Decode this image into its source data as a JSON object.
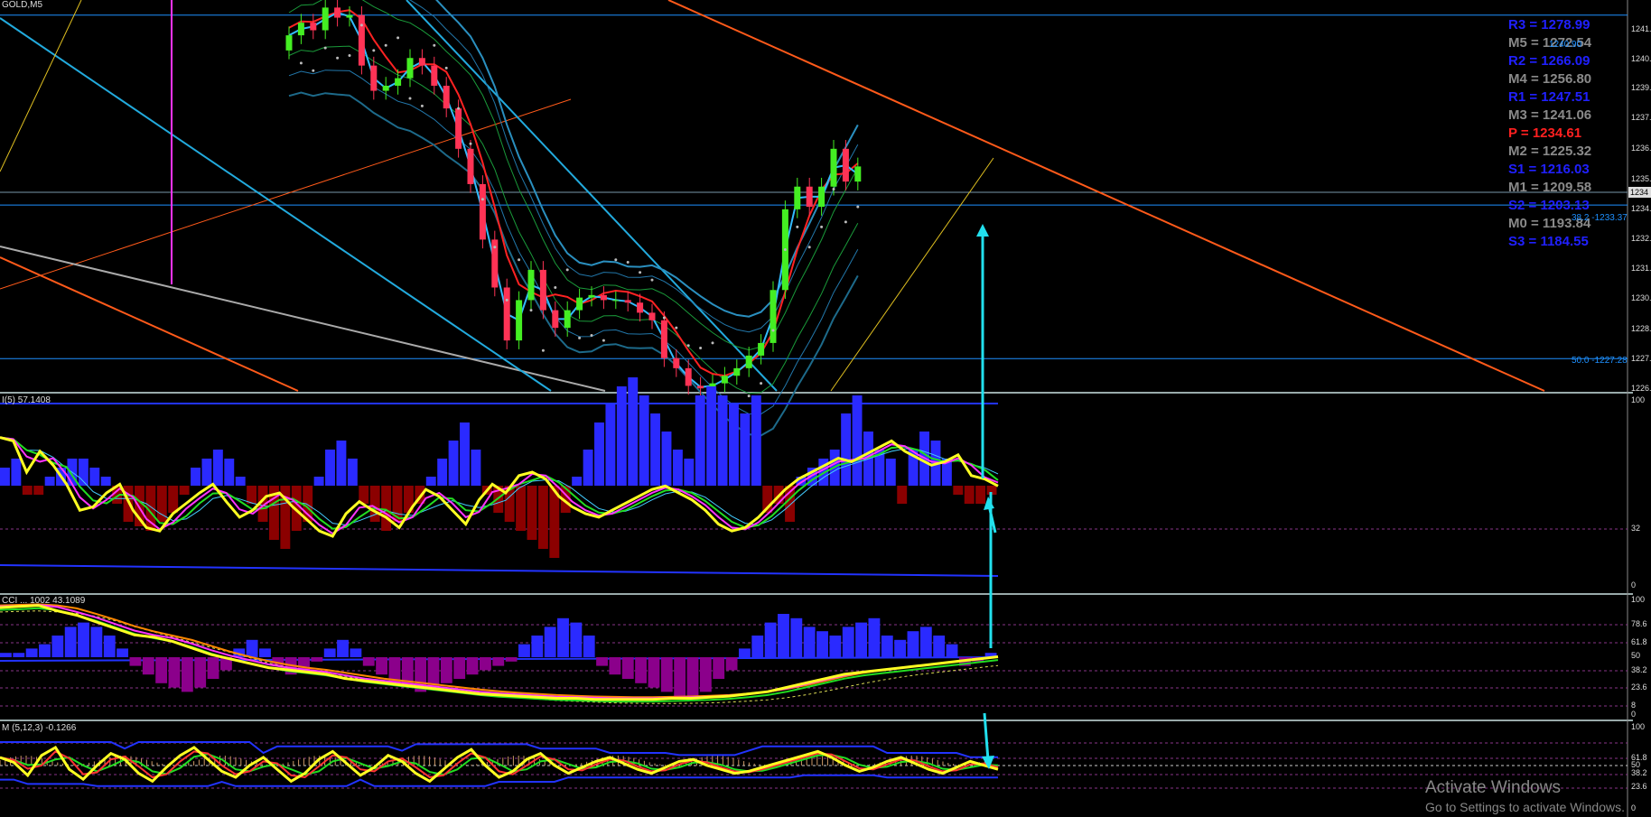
{
  "window": {
    "symbol_title": "GOLD,M5"
  },
  "chart_data": [
    {
      "type": "candlestick",
      "title": "GOLD,M5",
      "ylim": [
        1226,
        1241.5
      ],
      "y_ticks": [
        "1241.",
        "1240.",
        "1239.",
        "1237.",
        "1236.",
        "1235.",
        "1234.",
        "1232.",
        "1231.",
        "1230.",
        "1228.",
        "1227.",
        "1226."
      ],
      "current_price_label": "1234",
      "closes": [
        1240.1,
        1240.6,
        1240.3,
        1241.2,
        1240.8,
        1240.9,
        1238.9,
        1237.9,
        1238.1,
        1238.4,
        1239.2,
        1238.9,
        1238.1,
        1237.2,
        1235.6,
        1234.2,
        1232.0,
        1230.1,
        1228.0,
        1229.6,
        1230.8,
        1229.2,
        1228.5,
        1229.2,
        1229.7,
        1229.8,
        1229.6,
        1229.6,
        1229.5,
        1229.1,
        1228.8,
        1227.3,
        1226.9,
        1226.2,
        1226.1,
        1226.3,
        1226.6,
        1226.9,
        1227.4,
        1227.9,
        1230.0,
        1233.2,
        1234.1,
        1233.3,
        1234.1,
        1235.6,
        1234.3,
        1234.9
      ],
      "horizontal_levels": [
        {
          "label": "1240.90",
          "price": 1240.9
        },
        {
          "label": "38.2 -1233.37",
          "price": 1233.37
        },
        {
          "label": "50.0 -1227.28",
          "price": 1227.28
        }
      ],
      "pivot_levels": [
        {
          "label": "R3 = 1278.99",
          "color": "#2020ff"
        },
        {
          "label": "M5 = 1272.54",
          "color": "#8a8a8a"
        },
        {
          "label": "R2 = 1266.09",
          "color": "#2020ff"
        },
        {
          "label": "M4 = 1256.80",
          "color": "#8a8a8a"
        },
        {
          "label": "R1 = 1247.51",
          "color": "#2020ff"
        },
        {
          "label": "M3 = 1241.06",
          "color": "#8a8a8a"
        },
        {
          "label": "P  = 1234.61",
          "color": "#ff2020"
        },
        {
          "label": "M2 = 1225.32",
          "color": "#8a8a8a"
        },
        {
          "label": "S1 = 1216.03",
          "color": "#2020ff"
        },
        {
          "label": "M1 = 1209.58",
          "color": "#8a8a8a"
        },
        {
          "label": "S2 = 1203.13",
          "color": "#2020ff"
        },
        {
          "label": "M0 = 1193.84",
          "color": "#8a8a8a"
        },
        {
          "label": "S3 = 1184.55",
          "color": "#2020ff"
        }
      ]
    },
    {
      "type": "histogram+line",
      "title": "(5) 57.1408",
      "ylim": [
        0,
        100
      ],
      "y_ticks": [
        "100",
        "32",
        "0"
      ],
      "histogram": [
        4,
        6,
        -2,
        -2,
        2,
        4,
        6,
        6,
        4,
        2,
        -4,
        -8,
        -9,
        -10,
        -8,
        -6,
        -2,
        4,
        6,
        8,
        6,
        2,
        -4,
        -8,
        -12,
        -14,
        -10,
        -8,
        2,
        8,
        10,
        6,
        -4,
        -8,
        -10,
        -8,
        -6,
        -4,
        2,
        6,
        10,
        14,
        8,
        -2,
        -6,
        -8,
        -10,
        -12,
        -14,
        -16,
        -6,
        2,
        8,
        14,
        18,
        22,
        24,
        20,
        16,
        12,
        8,
        6,
        20,
        22,
        20,
        18,
        16,
        20,
        -6,
        -4,
        -8,
        2,
        4,
        6,
        8,
        16,
        20,
        12,
        8,
        6,
        -4,
        8,
        12,
        10,
        6,
        -2,
        -4,
        -4,
        -2
      ],
      "line_values": [
        82,
        80,
        62,
        74,
        66,
        55,
        40,
        42,
        50,
        55,
        40,
        30,
        28,
        38,
        44,
        50,
        55,
        45,
        36,
        40,
        48,
        50,
        42,
        35,
        28,
        25,
        38,
        45,
        40,
        36,
        30,
        42,
        52,
        48,
        40,
        32,
        46,
        55,
        50,
        60,
        62,
        58,
        48,
        42,
        38,
        36,
        40,
        44,
        48,
        52,
        54,
        50,
        46,
        40,
        32,
        28,
        30,
        36,
        44,
        52,
        58,
        62,
        66,
        70,
        68,
        72,
        76,
        80,
        74,
        70,
        66,
        68,
        72,
        60,
        58,
        54
      ]
    },
    {
      "type": "histogram+line",
      "title": "CCI 43.1089",
      "y_ticks": [
        "100",
        "78.6",
        "61.8",
        "50",
        "38.2",
        "23.6",
        "8",
        "0"
      ],
      "histogram": [
        2,
        2,
        4,
        6,
        10,
        14,
        16,
        14,
        10,
        4,
        -4,
        -8,
        -12,
        -14,
        -16,
        -14,
        -10,
        -6,
        4,
        8,
        4,
        -4,
        -8,
        -6,
        -2,
        4,
        8,
        4,
        -4,
        -8,
        -12,
        -14,
        -16,
        -14,
        -12,
        -10,
        -8,
        -6,
        -4,
        -2,
        6,
        10,
        14,
        18,
        16,
        10,
        -4,
        -8,
        -10,
        -12,
        -14,
        -16,
        -18,
        -20,
        -16,
        -10,
        -6,
        4,
        10,
        16,
        20,
        18,
        14,
        12,
        10,
        14,
        16,
        18,
        10,
        8,
        12,
        14,
        10,
        6,
        -4,
        -2,
        2
      ],
      "line_values": [
        95,
        96,
        97,
        92,
        88,
        82,
        76,
        70,
        68,
        64,
        58,
        52,
        48,
        44,
        40,
        38,
        36,
        34,
        30,
        28,
        26,
        24,
        22,
        20,
        18,
        16,
        15,
        14,
        13,
        12,
        12,
        11,
        11,
        11,
        11,
        12,
        12,
        13,
        14,
        16,
        18,
        22,
        26,
        30,
        34,
        36,
        38,
        40,
        42,
        44,
        46,
        48,
        50
      ]
    },
    {
      "type": "line",
      "title": "(5,12,3) -0.1266",
      "y_ticks": [
        "100",
        "61.8",
        "50",
        "38.2",
        "23.6",
        "0"
      ],
      "line_values": [
        60,
        55,
        42,
        62,
        70,
        48,
        38,
        52,
        64,
        58,
        44,
        36,
        50,
        62,
        70,
        58,
        46,
        40,
        52,
        60,
        48,
        36,
        44,
        58,
        66,
        54,
        42,
        50,
        62,
        56,
        44,
        36,
        48,
        60,
        68,
        52,
        40,
        46,
        58,
        64,
        52,
        44,
        50,
        56,
        60,
        54,
        48,
        44,
        50,
        56,
        58,
        52,
        48,
        44,
        46,
        50,
        54,
        58,
        62,
        66,
        60,
        52,
        46,
        50,
        56,
        60,
        54,
        48,
        44,
        50,
        56,
        52,
        48
      ]
    }
  ],
  "subwindow_titles": {
    "rsi": "I(5) 57.1408",
    "cci": "CCI ... 1002 43.1089",
    "macd": "M (5,12,3) -0.1266"
  },
  "watermark": {
    "line1": "Activate Windows",
    "line2": "Go to Settings to activate Windows."
  }
}
